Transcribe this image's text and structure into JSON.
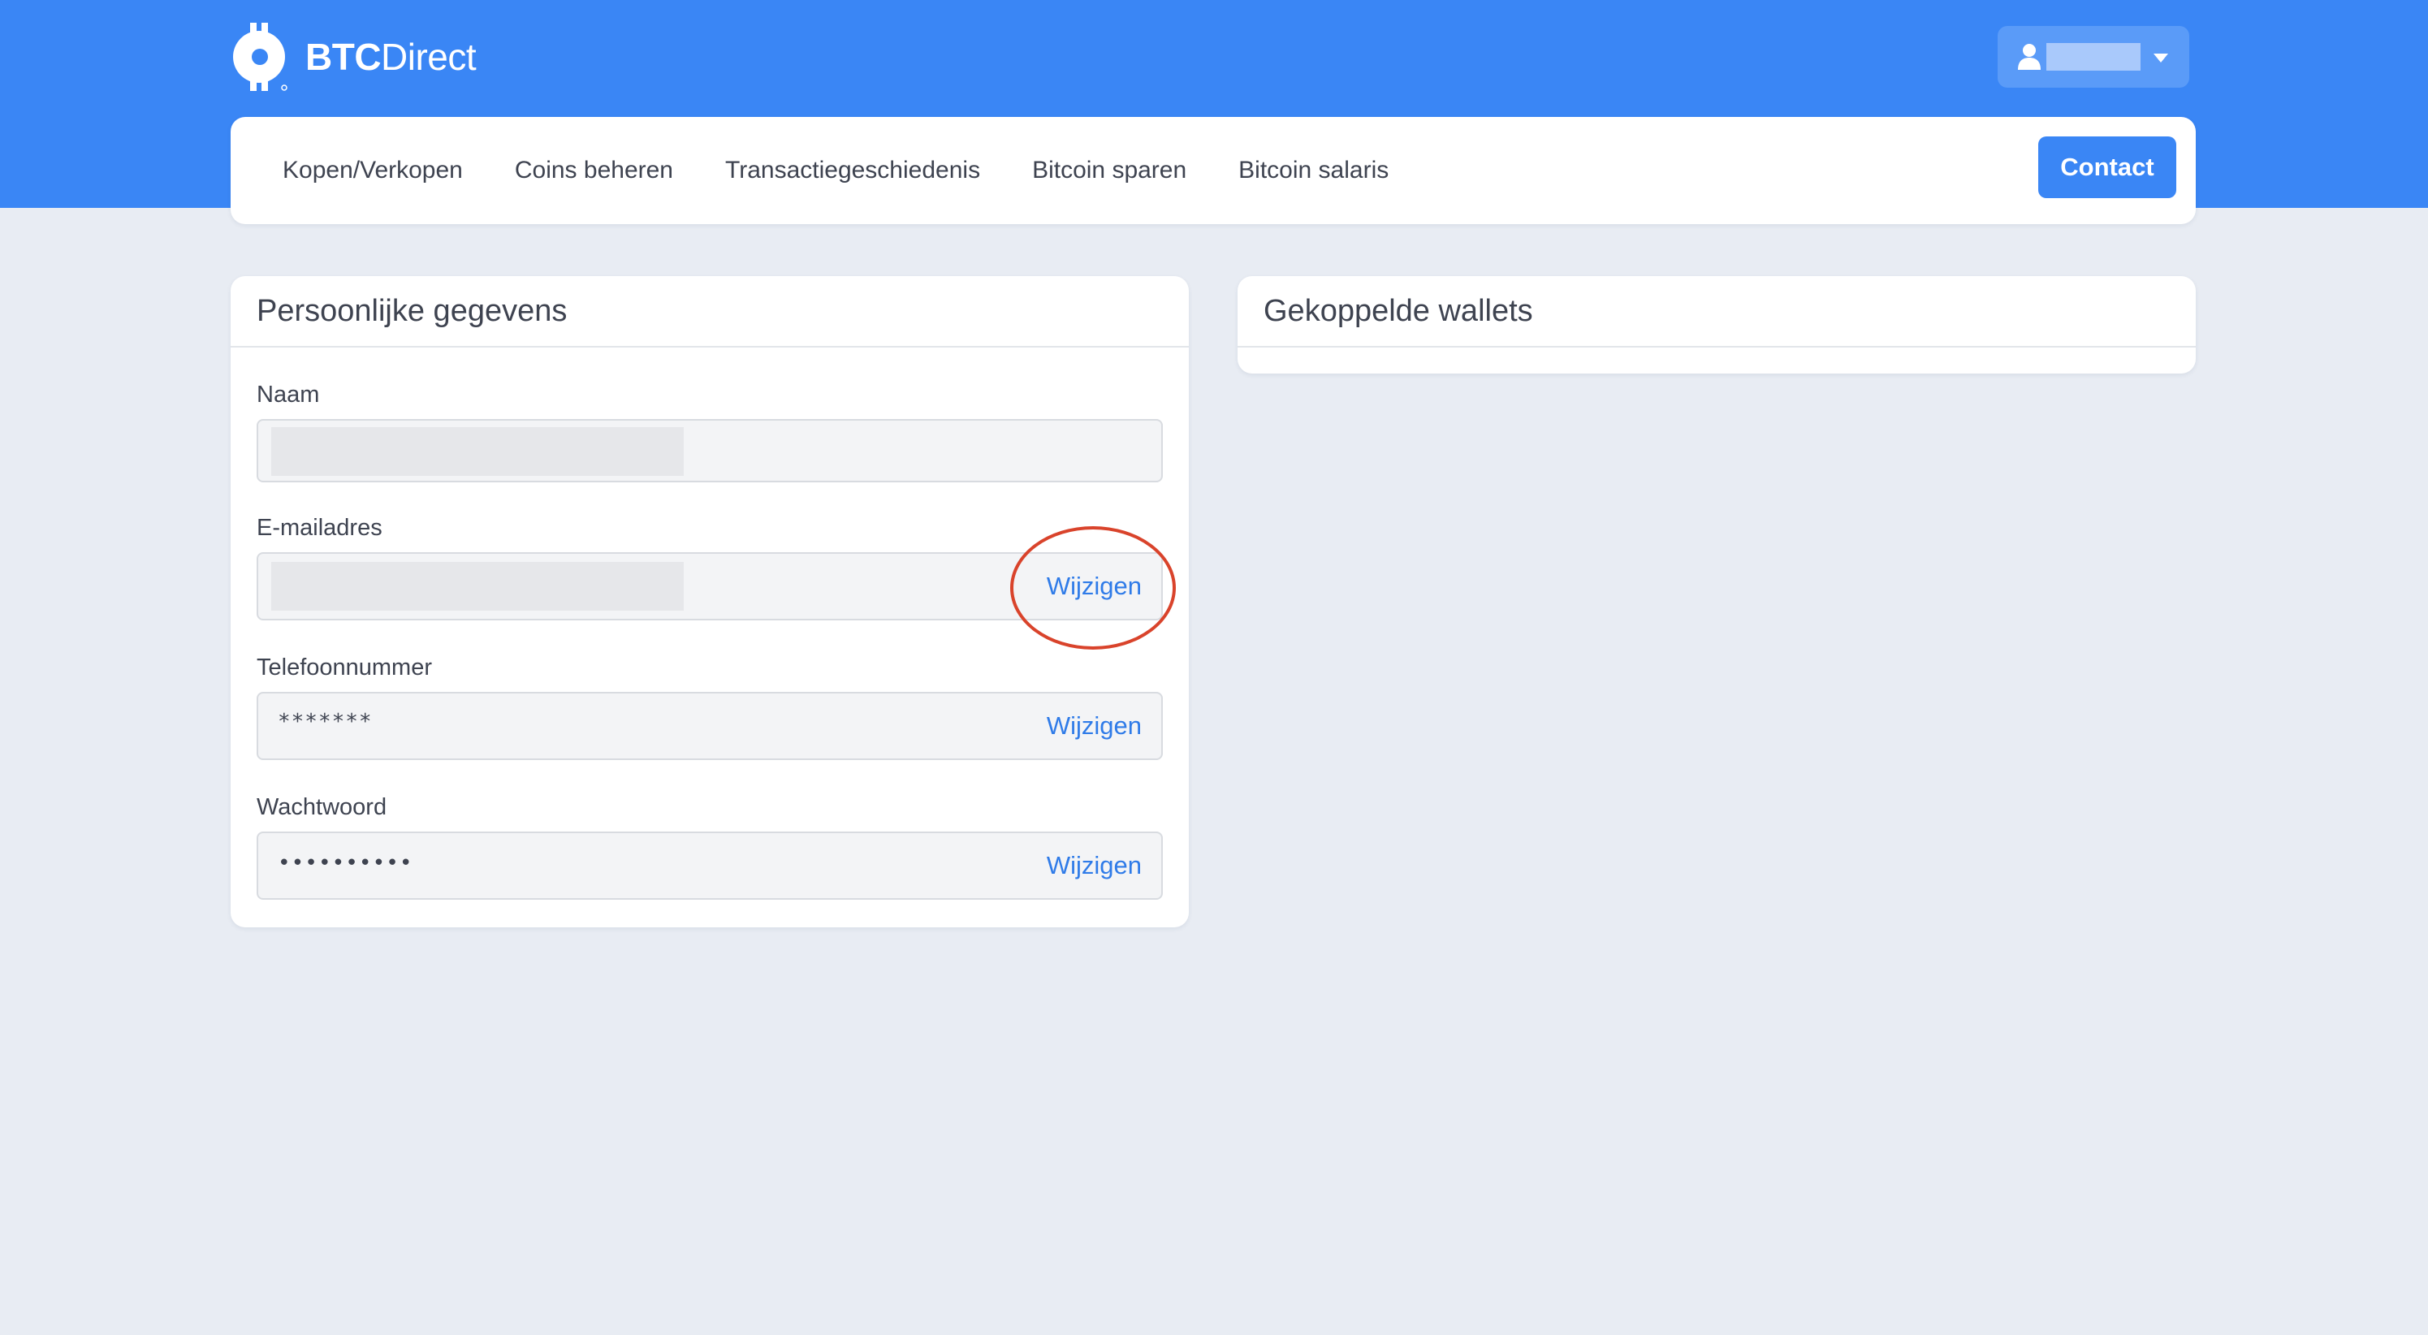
{
  "brand": {
    "name_bold": "BTC",
    "name_light": "Direct",
    "color_primary": "#3a86f5"
  },
  "user_menu": {
    "username": "",
    "icon": "user-icon",
    "caret_icon": "caret-down-icon"
  },
  "nav": {
    "items": [
      "Kopen/Verkopen",
      "Coins beheren",
      "Transactiegeschiedenis",
      "Bitcoin sparen",
      "Bitcoin salaris"
    ],
    "contact_label": "Contact"
  },
  "personal": {
    "title": "Persoonlijke gegevens",
    "name_label": "Naam",
    "name_value": "",
    "email_label": "E-mailadres",
    "email_value": "",
    "email_edit": "Wijzigen",
    "phone_label": "Telefoonnummer",
    "phone_value": "*******",
    "phone_edit": "Wijzigen",
    "password_label": "Wachtwoord",
    "password_value": "••••••••••",
    "password_edit": "Wijzigen"
  },
  "wallets": {
    "title": "Gekoppelde wallets"
  },
  "annotation": {
    "color": "#d9432b"
  }
}
